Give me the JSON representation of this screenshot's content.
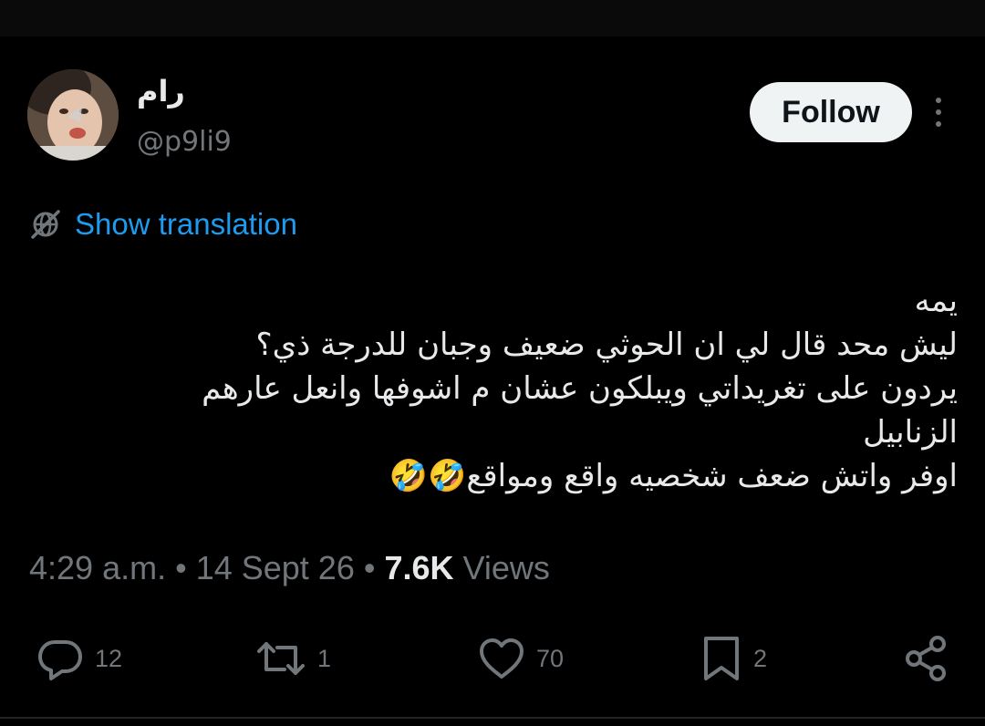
{
  "user": {
    "display_name": "رام",
    "handle": "@p9li9"
  },
  "header": {
    "follow_label": "Follow",
    "more_icon": "more-vertical-icon"
  },
  "translation": {
    "label": "Show translation",
    "icon": "globe-slash-icon"
  },
  "tweet": {
    "lines": [
      "يمه",
      "ليش محد قال لي ان الحوثي ضعيف وجبان للدرجة ذي؟",
      "يردون على تغريداتي ويبلكون عشان م اشوفها وانعل عارهم",
      "الزنابيل",
      "اوفر واتش ضعف شخصيه واقع ومواقع🤣🤣"
    ]
  },
  "meta": {
    "time": "4:29 a.m.",
    "separator": "•",
    "date": "14 Sept 26",
    "views_count": "7.6K",
    "views_label": "Views"
  },
  "actions": {
    "replies": "12",
    "reposts": "1",
    "likes": "70",
    "bookmarks": "2"
  },
  "colors": {
    "background": "#000000",
    "text": "#e7e9ea",
    "muted": "#71767b",
    "link": "#1d9bf0",
    "follow_bg": "#eff3f4"
  }
}
